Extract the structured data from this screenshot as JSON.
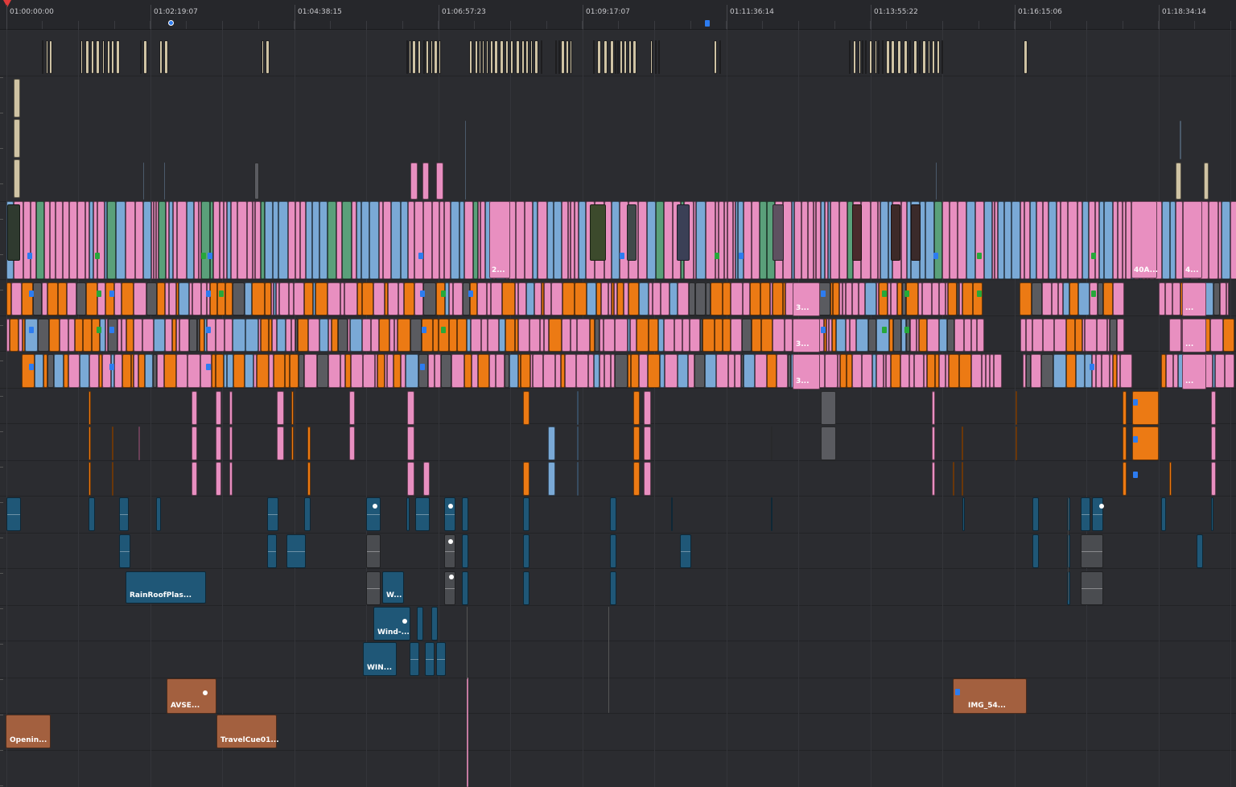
{
  "ruler": {
    "timecodes": [
      "01:00:00:00",
      "01:02:19:07",
      "01:04:38:15",
      "01:06:57:23",
      "01:09:17:07",
      "01:11:36:14",
      "01:13:55:22",
      "01:16:15:06",
      "01:18:34:14"
    ]
  },
  "clips": {
    "rain_roof": "RainRoofPlas...",
    "w_short": "W...",
    "wind": "Wind-...",
    "win": "WIN...",
    "avse": "AVSE...",
    "opening": "Openin...",
    "travel_cue": "TravelCue01...",
    "img54": "IMG_54...",
    "v1_2": "2...",
    "v1_40a": "40A...",
    "v1_4": "4...",
    "v2_3a": "3...",
    "v3_3a": "3...",
    "v4_3a": "3...",
    "v2_dots": "...",
    "v3_dots": "...",
    "v4_dots": "..."
  },
  "colors": {
    "pink": "#e88fc0",
    "blue": "#7aa9d6",
    "orange": "#ec7a14",
    "beige": "#cfc3a4",
    "audio_teal": "#1f5777",
    "audio_brown": "#a3603f",
    "gray": "#5a5b60",
    "marker_blue": "#2d7cf0",
    "marker_green": "#27a83a"
  }
}
